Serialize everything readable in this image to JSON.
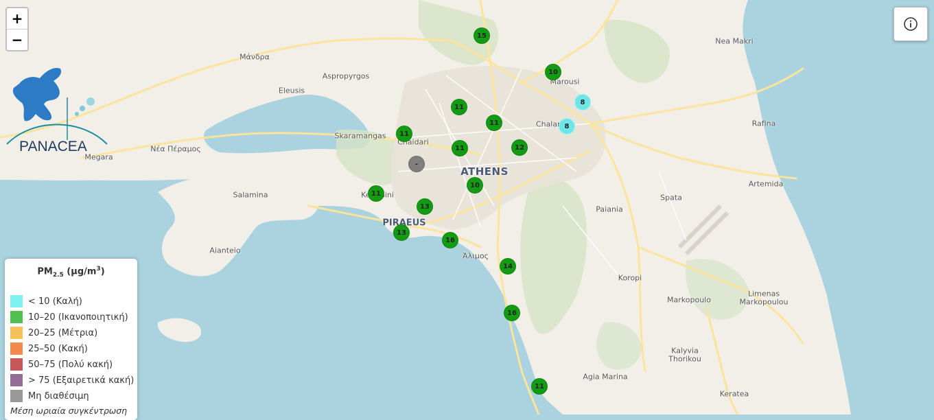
{
  "map": {
    "land_color": "#f2efe9",
    "water_color": "#aad3df",
    "park_color": "#d6e4c6",
    "road_color": "#fde49c"
  },
  "zoom": {
    "in_label": "+",
    "out_label": "−"
  },
  "info_button": {
    "icon": "info-icon"
  },
  "logo": {
    "text": "PANACEA"
  },
  "places": [
    {
      "id": "mandra",
      "label": "Μάνδρα",
      "cls": ""
    },
    {
      "id": "aspropyrgos",
      "label": "Aspropyrgos",
      "cls": ""
    },
    {
      "id": "eleusis",
      "label": "Eleusis",
      "cls": ""
    },
    {
      "id": "skaramangas",
      "label": "Skaramangas",
      "cls": ""
    },
    {
      "id": "chaidari",
      "label": "Chaidari",
      "cls": ""
    },
    {
      "id": "nea-peramos",
      "label": "Νέα Πέραμος",
      "cls": ""
    },
    {
      "id": "megara",
      "label": "Megara",
      "cls": ""
    },
    {
      "id": "salamina",
      "label": "Salamina",
      "cls": ""
    },
    {
      "id": "keratsini",
      "label": "Keratsini",
      "cls": ""
    },
    {
      "id": "piraeus",
      "label": "PIRAEUS",
      "cls": "mid"
    },
    {
      "id": "athens",
      "label": "ATHENS",
      "cls": "big"
    },
    {
      "id": "aianteio",
      "label": "Aianteio",
      "cls": ""
    },
    {
      "id": "alimos",
      "label": "Άλιμος",
      "cls": ""
    },
    {
      "id": "marousi",
      "label": "Marousi",
      "cls": ""
    },
    {
      "id": "chalandri",
      "label": "Chalan",
      "cls": ""
    },
    {
      "id": "nea-makri",
      "label": "Nea Makri",
      "cls": ""
    },
    {
      "id": "rafina",
      "label": "Rafina",
      "cls": ""
    },
    {
      "id": "artemida",
      "label": "Artemida",
      "cls": ""
    },
    {
      "id": "spata",
      "label": "Spata",
      "cls": ""
    },
    {
      "id": "paiania",
      "label": "Paiania",
      "cls": ""
    },
    {
      "id": "koropi",
      "label": "Koropi",
      "cls": ""
    },
    {
      "id": "markopoulo",
      "label": "Markopoulo",
      "cls": ""
    },
    {
      "id": "limenas",
      "label": "Limenas",
      "cls": ""
    },
    {
      "id": "limenas2",
      "label": "Markopoulou",
      "cls": ""
    },
    {
      "id": "kalyvia",
      "label": "Kalyvia",
      "cls": ""
    },
    {
      "id": "thorikou",
      "label": "Thorikou",
      "cls": ""
    },
    {
      "id": "agia-marina",
      "label": "Agia Marina",
      "cls": ""
    },
    {
      "id": "keratea",
      "label": "Keratea",
      "cls": ""
    }
  ],
  "stations": [
    {
      "value": "15",
      "category": "moderate-good"
    },
    {
      "value": "10",
      "category": "moderate-good"
    },
    {
      "value": "8",
      "category": "good"
    },
    {
      "value": "8",
      "category": "good"
    },
    {
      "value": "11",
      "category": "moderate-good"
    },
    {
      "value": "11",
      "category": "moderate-good"
    },
    {
      "value": "11",
      "category": "moderate-good"
    },
    {
      "value": "11",
      "category": "moderate-good"
    },
    {
      "value": "12",
      "category": "moderate-good"
    },
    {
      "value": "-",
      "category": "na"
    },
    {
      "value": "10",
      "category": "moderate-good"
    },
    {
      "value": "11",
      "category": "moderate-good"
    },
    {
      "value": "13",
      "category": "moderate-good"
    },
    {
      "value": "13",
      "category": "moderate-good"
    },
    {
      "value": "16",
      "category": "moderate-good"
    },
    {
      "value": "14",
      "category": "moderate-good"
    },
    {
      "value": "16",
      "category": "moderate-good"
    },
    {
      "value": "11",
      "category": "moderate-good"
    }
  ],
  "category_colors": {
    "good": "#6fe6e6",
    "moderate-good": "#139c13",
    "na": "#7f7f7f"
  },
  "legend": {
    "title_pm": "PM",
    "title_sub": "2.5",
    "title_unit_open": " (μg/m",
    "title_sup": "3",
    "title_unit_close": ")",
    "items": [
      {
        "label": "< 10 (Καλή)",
        "color": "#7ff0f0"
      },
      {
        "label": "10–20 (Ικανοποιητική)",
        "color": "#50c050"
      },
      {
        "label": "20–25 (Μέτρια)",
        "color": "#f7c05a"
      },
      {
        "label": "25–50 (Κακή)",
        "color": "#f5884d"
      },
      {
        "label": "50–75 (Πολύ κακή)",
        "color": "#c8575a"
      },
      {
        "label": "> 75 (Εξαιρετικά κακή)",
        "color": "#936b95"
      },
      {
        "label": "Μη διαθέσιμη",
        "color": "#999999"
      }
    ],
    "footer": "Μέση ωριαία συγκέντρωση"
  }
}
